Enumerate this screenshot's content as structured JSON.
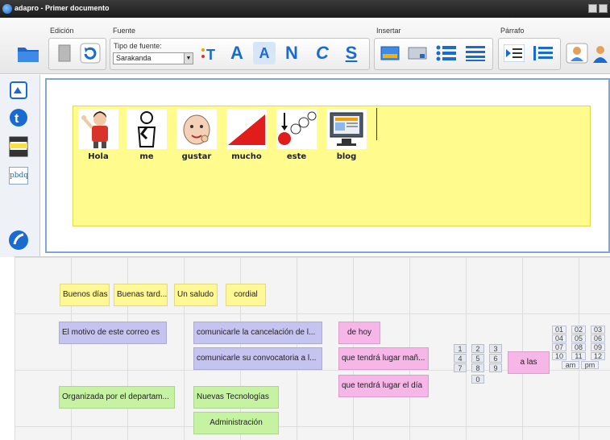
{
  "window": {
    "title": "adapro - Primer documento"
  },
  "ribbon": {
    "groups": {
      "edicion": "Edición",
      "fuente": "Fuente",
      "insertar": "Insertar",
      "parrafo": "Párrafo"
    },
    "font_type_label": "Tipo de fuente:",
    "font_value": "Sarakanda",
    "letters": {
      "aa": "A",
      "n": "N",
      "c": "C",
      "s": "S"
    }
  },
  "sidebar": {
    "pbdq_label": "pbdq"
  },
  "document": {
    "pictograms": [
      {
        "word": "Hola",
        "icon": "girl-waving-icon"
      },
      {
        "word": "me",
        "icon": "person-pointing-self-icon"
      },
      {
        "word": "gustar",
        "icon": "happy-face-icon"
      },
      {
        "word": "mucho",
        "icon": "red-wedge-icon"
      },
      {
        "word": "este",
        "icon": "pointing-dot-icon"
      },
      {
        "word": "blog",
        "icon": "computer-screen-icon"
      }
    ]
  },
  "phrases": {
    "greetings": [
      "Buenos días",
      "Buenas tard...",
      "Un saludo",
      "cordial"
    ],
    "reason": "El motivo de este correo es",
    "cancel": "comunicarle la cancelación de l...",
    "convocation": "comunicarle su convocatoria a l...",
    "today": "de hoy",
    "tomorrow": "que tendrá lugar mañ...",
    "onday": "que tendrá lugar el día",
    "organized": "Organizada por el departam...",
    "newtech": "Nuevas Tecnologías",
    "admin": "Administración",
    "at": "a las",
    "digits": [
      "1",
      "2",
      "3",
      "4",
      "5",
      "6",
      "7",
      "8",
      "9",
      "0"
    ],
    "hours": [
      "01",
      "02",
      "03",
      "04",
      "05",
      "06",
      "07",
      "08",
      "09",
      "10",
      "11",
      "12"
    ],
    "ampm": [
      "am",
      "pm"
    ]
  },
  "colors": {
    "yellow_chip": "#fff894",
    "purple_chip": "#c5c3f0",
    "pink_chip": "#f7b6e8",
    "green_chip": "#c6f3a2",
    "doc_strip": "#fffb8c",
    "accent_blue": "#1a6bd1"
  }
}
